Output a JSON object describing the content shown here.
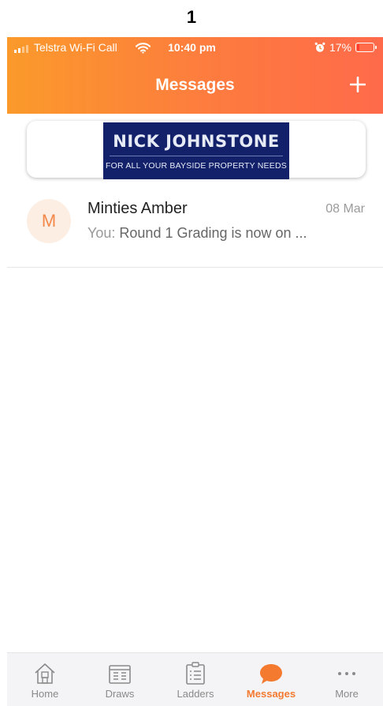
{
  "page_number": "1",
  "status_bar": {
    "carrier": "Telstra Wi-Fi Call",
    "time": "10:40 pm",
    "battery_percent": "17%",
    "battery_level": 0.17,
    "battery_color": "#ff3b30"
  },
  "header": {
    "title": "Messages",
    "add_label": "+",
    "gradient_start": "#fb9a2b",
    "gradient_end": "#fe6a4a"
  },
  "banner": {
    "name": "NICK JOHNSTONE",
    "tagline": "FOR ALL YOUR BAYSIDE PROPERTY NEEDS",
    "background": "#13216b"
  },
  "conversations": [
    {
      "initial": "M",
      "name": "Minties Amber",
      "date": "08 Mar",
      "sender_prefix": "You:",
      "preview": "Round 1 Grading is now on ..."
    }
  ],
  "tabs": [
    {
      "label": "Home",
      "icon": "home-icon",
      "active": false
    },
    {
      "label": "Draws",
      "icon": "draws-icon",
      "active": false
    },
    {
      "label": "Ladders",
      "icon": "ladders-icon",
      "active": false
    },
    {
      "label": "Messages",
      "icon": "messages-icon",
      "active": true
    },
    {
      "label": "More",
      "icon": "more-icon",
      "active": false
    }
  ],
  "accent_color": "#f47a30"
}
